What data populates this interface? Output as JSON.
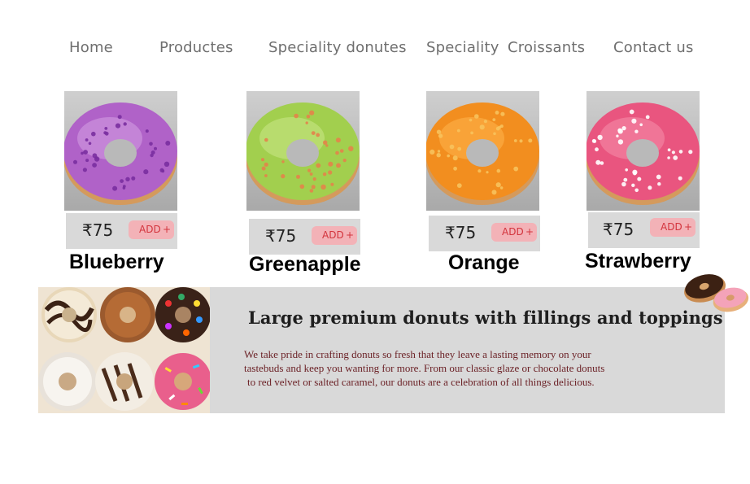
{
  "nav": {
    "items": [
      {
        "label": "Home"
      },
      {
        "label": "Productes"
      },
      {
        "label": "Speciality donutes"
      },
      {
        "label": "Speciality"
      },
      {
        "label": "Croissants"
      },
      {
        "label": "Contact us"
      }
    ]
  },
  "products": [
    {
      "name": "Blueberry",
      "price": "₹75",
      "add_label": "ADD",
      "add_icon": "+",
      "icing": "#b062c8",
      "icing_light": "#d6a1e3",
      "sprinkles": "#7a2fa0"
    },
    {
      "name": "Greenapple",
      "price": "₹75",
      "add_label": "ADD",
      "add_icon": "+",
      "icing": "#a2cf4e",
      "icing_light": "#cbe889",
      "sprinkles": "#e3834a"
    },
    {
      "name": "Orange",
      "price": "₹75",
      "add_label": "ADD",
      "add_icon": "+",
      "icing": "#f28e1f",
      "icing_light": "#ffb54d",
      "sprinkles": "#f7c25c"
    },
    {
      "name": "Strawberry",
      "price": "₹75",
      "add_label": "ADD",
      "add_icon": "+",
      "icing": "#e9557f",
      "icing_light": "#f590ac",
      "sprinkles": "#ffffff"
    }
  ],
  "banner": {
    "title": "Large premium donuts with fillings and toppings",
    "lines": [
      "We take pride in crafting donuts so fresh that they leave a lasting memory on your",
      "tastebuds and keep you wanting for more. From our classic glaze or chocolate donuts",
      "to red velvet or salted caramel, our donuts are a celebration of all things delicious."
    ]
  },
  "colors": {
    "nav_text": "#6f6f6f",
    "add_button_bg": "#f3b2b7",
    "add_button_text": "#d3343d",
    "banner_bg": "#d9d9d9",
    "banner_text": "#6a1f24"
  }
}
